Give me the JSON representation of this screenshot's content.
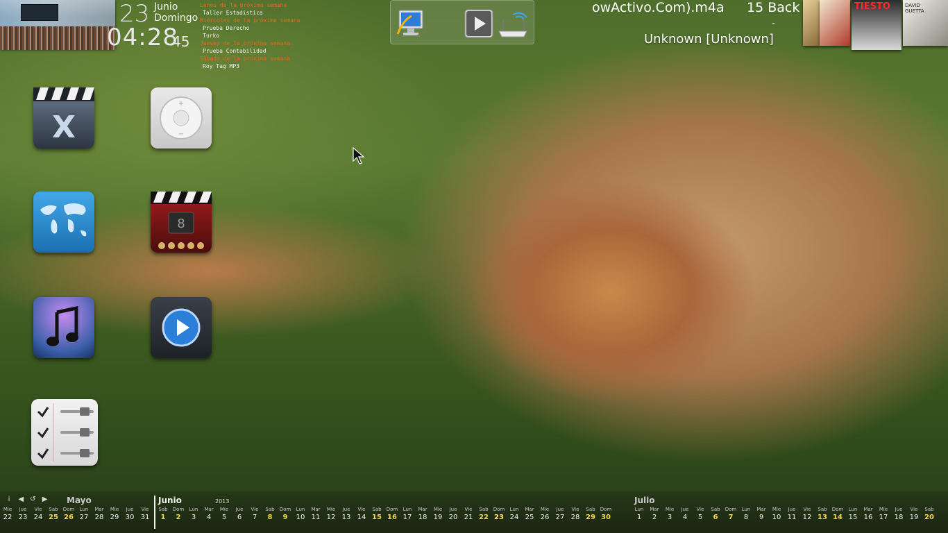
{
  "clock": {
    "day": "23",
    "month": "Junio",
    "weekday": "Domingo",
    "time": "04:28",
    "seconds": "45"
  },
  "agenda": [
    {
      "heading": "Lunes de la próxima semana",
      "items": [
        "Taller Estadistica",
        "Prueba Derecho",
        "Turko"
      ]
    },
    {
      "heading": "Miércoles de la próxima semana",
      "items": []
    },
    {
      "heading": "Jueves de la próxima semana",
      "items": [
        "Prueba Contabilidad"
      ]
    },
    {
      "heading": "Sábado de la próxima semana",
      "items": [
        "Roy Tag MP3"
      ]
    }
  ],
  "toolbar": {
    "icons": [
      "monitor-icon",
      "play-icon",
      "wifi-router-icon"
    ]
  },
  "now_playing": {
    "title": "owActivo.Com).m4a",
    "track": "15 Back",
    "dash": "-",
    "artist": "Unknown [Unknown]"
  },
  "album_covers": [
    {
      "name": "album-cover-1",
      "color": "#c8ab6a"
    },
    {
      "name": "album-cover-2",
      "color": "#b23a2a"
    },
    {
      "name": "album-cover-3",
      "color": "#1c1c1c",
      "label": "TIESTO"
    },
    {
      "name": "album-cover-4",
      "color": "#d8d2c4",
      "label": "DAVID GUETTA"
    }
  ],
  "dock": [
    {
      "name": "x-app-icon",
      "label": "X"
    },
    {
      "name": "ipod-shuffle-icon",
      "label": ""
    },
    {
      "name": "world-map-icon",
      "label": ""
    },
    {
      "name": "movie-clapper-icon",
      "label": "8"
    },
    {
      "name": "itunes-icon",
      "label": ""
    },
    {
      "name": "media-player-icon",
      "label": ""
    },
    {
      "name": "settings-checklist-icon",
      "label": ""
    }
  ],
  "calendar": {
    "controls": [
      "info",
      "prev",
      "refresh",
      "next"
    ],
    "months": [
      {
        "name": "Mayo",
        "year": ""
      },
      {
        "name": "Junio",
        "year": "2013"
      },
      {
        "name": "Julio",
        "year": ""
      }
    ],
    "may_days": [
      {
        "dn": "Mie",
        "n": "22"
      },
      {
        "dn": "Jue",
        "n": "23"
      },
      {
        "dn": "Vie",
        "n": "24"
      },
      {
        "dn": "Sab",
        "n": "25"
      },
      {
        "dn": "Dom",
        "n": "26"
      },
      {
        "dn": "Lun",
        "n": "27"
      },
      {
        "dn": "Mar",
        "n": "28"
      },
      {
        "dn": "Mie",
        "n": "29"
      },
      {
        "dn": "Jue",
        "n": "30"
      },
      {
        "dn": "Vie",
        "n": "31"
      }
    ],
    "june_days": [
      {
        "dn": "Sab",
        "n": "1"
      },
      {
        "dn": "Dom",
        "n": "2"
      },
      {
        "dn": "Lun",
        "n": "3"
      },
      {
        "dn": "Mar",
        "n": "4"
      },
      {
        "dn": "Mie",
        "n": "5"
      },
      {
        "dn": "Jue",
        "n": "6"
      },
      {
        "dn": "Vie",
        "n": "7"
      },
      {
        "dn": "Sab",
        "n": "8"
      },
      {
        "dn": "Dom",
        "n": "9"
      },
      {
        "dn": "Lun",
        "n": "10"
      },
      {
        "dn": "Mar",
        "n": "11"
      },
      {
        "dn": "Mie",
        "n": "12"
      },
      {
        "dn": "Jue",
        "n": "13"
      },
      {
        "dn": "Vie",
        "n": "14"
      },
      {
        "dn": "Sab",
        "n": "15"
      },
      {
        "dn": "Dom",
        "n": "16"
      },
      {
        "dn": "Lun",
        "n": "17"
      },
      {
        "dn": "Mar",
        "n": "18"
      },
      {
        "dn": "Mie",
        "n": "19"
      },
      {
        "dn": "Jue",
        "n": "20"
      },
      {
        "dn": "Vie",
        "n": "21"
      },
      {
        "dn": "Sab",
        "n": "22"
      },
      {
        "dn": "Dom",
        "n": "23"
      },
      {
        "dn": "Lun",
        "n": "24"
      },
      {
        "dn": "Mar",
        "n": "25"
      },
      {
        "dn": "Mie",
        "n": "26"
      },
      {
        "dn": "Jue",
        "n": "27"
      },
      {
        "dn": "Vie",
        "n": "28"
      },
      {
        "dn": "Sab",
        "n": "29"
      },
      {
        "dn": "Dom",
        "n": "30"
      }
    ],
    "july_days": [
      {
        "dn": "Lun",
        "n": "1"
      },
      {
        "dn": "Mar",
        "n": "2"
      },
      {
        "dn": "Mie",
        "n": "3"
      },
      {
        "dn": "Jue",
        "n": "4"
      },
      {
        "dn": "Vie",
        "n": "5"
      },
      {
        "dn": "Sab",
        "n": "6"
      },
      {
        "dn": "Dom",
        "n": "7"
      },
      {
        "dn": "Lun",
        "n": "8"
      },
      {
        "dn": "Mar",
        "n": "9"
      },
      {
        "dn": "Mie",
        "n": "10"
      },
      {
        "dn": "Jue",
        "n": "11"
      },
      {
        "dn": "Vie",
        "n": "12"
      },
      {
        "dn": "Sab",
        "n": "13"
      },
      {
        "dn": "Dom",
        "n": "14"
      },
      {
        "dn": "Lun",
        "n": "15"
      },
      {
        "dn": "Mar",
        "n": "16"
      },
      {
        "dn": "Mie",
        "n": "17"
      },
      {
        "dn": "Jue",
        "n": "18"
      },
      {
        "dn": "Vie",
        "n": "19"
      },
      {
        "dn": "Sab",
        "n": "20"
      }
    ]
  }
}
